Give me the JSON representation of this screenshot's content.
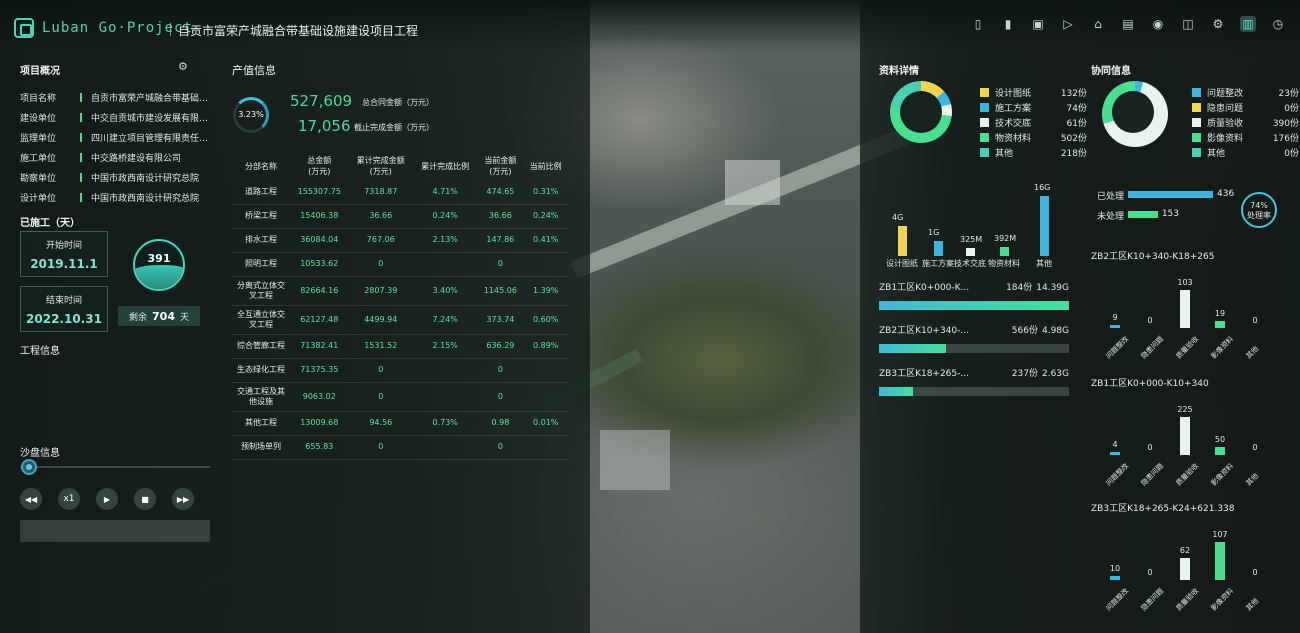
{
  "header": {
    "logo": "Luban Go·Project",
    "title": "自贡市富荣产城融合带基础设施建设项目工程",
    "icons": [
      "map-icon",
      "doc-icon",
      "video-icon",
      "play-icon",
      "home-icon",
      "image-icon",
      "eye-icon",
      "layers-icon",
      "gear-icon",
      "chart-icon",
      "clock-icon"
    ]
  },
  "overview": {
    "title": "项目概况",
    "items": [
      {
        "k": "项目名称",
        "v": "自贡市富荣产城融合带基础设..."
      },
      {
        "k": "建设单位",
        "v": "中交自贡城市建设发展有限公司"
      },
      {
        "k": "监理单位",
        "v": "四川建立项目管理有限责任公司"
      },
      {
        "k": "施工单位",
        "v": "中交路桥建设有限公司"
      },
      {
        "k": "勘察单位",
        "v": "中国市政西南设计研究总院"
      },
      {
        "k": "设计单位",
        "v": "中国市政西南设计研究总院"
      }
    ]
  },
  "construction": {
    "title": "已施工（天）",
    "start_label": "开始时间",
    "start": "2019.11.1",
    "end_label": "结束时间",
    "end": "2022.10.31",
    "days": "391",
    "remain_label": "剩余",
    "remain": "704",
    "remain_unit": "天",
    "info_label": "工程信息"
  },
  "sand": {
    "title": "沙盘信息",
    "speed": "x1"
  },
  "production": {
    "title": "产值信息",
    "gauge": "3.23%",
    "contract": "527,609",
    "contract_label": "总合同金额（万元）",
    "done": "17,056",
    "done_label": "截止完成金额（万元）",
    "headers": [
      "分部名称",
      "总金额\n(万元)",
      "累计完成金额\n(万元)",
      "累计完成比例",
      "当前金额\n(万元)",
      "当前比例"
    ],
    "rows": [
      [
        "道路工程",
        "155307.75",
        "7318.87",
        "4.71%",
        "474.65",
        "0.31%"
      ],
      [
        "桥梁工程",
        "15406.38",
        "36.66",
        "0.24%",
        "36.66",
        "0.24%"
      ],
      [
        "排水工程",
        "36084.04",
        "767.06",
        "2.13%",
        "147.86",
        "0.41%"
      ],
      [
        "照明工程",
        "10533.62",
        "0",
        "",
        "0",
        ""
      ],
      [
        "分离式立体交叉工程",
        "82664.16",
        "2807.39",
        "3.40%",
        "1145.06",
        "1.39%"
      ],
      [
        "全互通立体交叉工程",
        "62127.48",
        "4499.94",
        "7.24%",
        "373.74",
        "0.60%"
      ],
      [
        "综合管廊工程",
        "71382.41",
        "1531.52",
        "2.15%",
        "636.29",
        "0.89%"
      ],
      [
        "生态绿化工程",
        "71375.35",
        "0",
        "",
        "0",
        ""
      ],
      [
        "交通工程及其他设施",
        "9063.02",
        "0",
        "",
        "0",
        ""
      ],
      [
        "其他工程",
        "13009.68",
        "94.56",
        "0.73%",
        "0.98",
        "0.01%"
      ],
      [
        "预制场单列",
        "655.83",
        "0",
        "",
        "0",
        ""
      ]
    ]
  },
  "docs": {
    "title": "资料详情",
    "legend": [
      {
        "label": "设计图纸",
        "value": "132份",
        "color": "#f2d54a"
      },
      {
        "label": "施工方案",
        "value": "74份",
        "color": "#3ab6e0"
      },
      {
        "label": "技术交底",
        "value": "61份",
        "color": "#e8f2ee"
      },
      {
        "label": "物资材料",
        "value": "502份",
        "color": "#46e08e"
      },
      {
        "label": "其他",
        "value": "218份",
        "color": "#49d0b0"
      }
    ],
    "sizes": [
      {
        "label": "设计图纸",
        "size": "4G",
        "value": 4,
        "color": "#f2d54a"
      },
      {
        "label": "施工方案",
        "size": "1G",
        "value": 1,
        "color": "#3ab6e0"
      },
      {
        "label": "技术交底",
        "size": "325M",
        "value": 0.32,
        "color": "#e8f2ee"
      },
      {
        "label": "物资材料",
        "size": "392M",
        "value": 0.39,
        "color": "#46e08e"
      },
      {
        "label": "其他",
        "size": "16G",
        "value": 16,
        "color": "#3ab6e0"
      }
    ],
    "zones": [
      {
        "name": "ZB1工区K0+000-K...",
        "count": "184份",
        "size": "14.39G",
        "fill": 1.0
      },
      {
        "name": "ZB2工区K10+340-...",
        "count": "566份",
        "size": "4.98G",
        "fill": 0.35
      },
      {
        "name": "ZB3工区K18+265-...",
        "count": "237份",
        "size": "2.63G",
        "fill": 0.18
      }
    ]
  },
  "collab": {
    "title": "协同信息",
    "legend": [
      {
        "label": "问题整改",
        "value": "23份",
        "color": "#3ab6e0"
      },
      {
        "label": "隐患问题",
        "value": "0份",
        "color": "#f2d54a"
      },
      {
        "label": "质量验收",
        "value": "390份",
        "color": "#e8f2ee"
      },
      {
        "label": "影像资料",
        "value": "176份",
        "color": "#46e08e"
      },
      {
        "label": "其他",
        "value": "0份",
        "color": "#49d0b0"
      }
    ],
    "handled_label": "已处理",
    "handled": "436",
    "unhandled_label": "未处理",
    "unhandled": "153",
    "rate": "74%",
    "rate_label": "处理率",
    "zones": [
      {
        "title": "ZB2工区K10+340-K18+265",
        "values": [
          9,
          0,
          103,
          19,
          0
        ]
      },
      {
        "title": "ZB1工区K0+000-K10+340",
        "values": [
          4,
          0,
          225,
          50,
          0
        ]
      },
      {
        "title": "ZB3工区K18+265-K24+621.338",
        "values": [
          10,
          0,
          62,
          107,
          0
        ]
      }
    ],
    "cats": [
      "问题整改",
      "隐患问题",
      "质量验收",
      "影像资料",
      "其他"
    ],
    "cat_colors": [
      "#3ab6e0",
      "#f2d54a",
      "#e8f2ee",
      "#46e08e",
      "#49d0b0"
    ]
  }
}
